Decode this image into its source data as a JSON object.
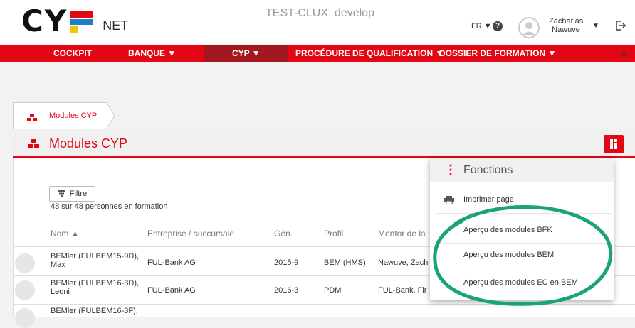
{
  "header": {
    "logo_letters": "CY",
    "logo_suffix": "NET",
    "env_title": "TEST-CLUX: develop",
    "language": "FR ▼",
    "help_label": "?",
    "user_first": "Zacharias",
    "user_last": "Nawuve",
    "user_caret": "▼"
  },
  "nav": {
    "items": [
      "COCKPIT",
      "BANQUE ▼",
      "CYP ▼",
      "PROCÉDURE DE QUALIFICATION ▼",
      "DOSSIER DE FORMATION ▼"
    ],
    "star": "★"
  },
  "breadcrumb": {
    "label": "Modules CYP"
  },
  "panel": {
    "title": "Modules CYP",
    "filter_label": "Filtre",
    "count_text": "48 sur 48 personnes en formation"
  },
  "table": {
    "columns": [
      "Nom ▲",
      "Entreprise / succursale",
      "Gén.",
      "Profil",
      "Mentor de la"
    ],
    "rows": [
      {
        "name1": "BEMler (FULBEM15-9D),",
        "name2": "Max",
        "company": "FUL-Bank AG",
        "gen": "2015-9",
        "profile": "BEM (HMS)",
        "mentor": "Nawuve, Zach"
      },
      {
        "name1": "BEMler (FULBEM16-3D),",
        "name2": "Leoni",
        "company": "FUL-Bank AG",
        "gen": "2016-3",
        "profile": "PDM",
        "mentor": "FUL-Bank, Fir"
      },
      {
        "name1": "BEMler (FULBEM16-3F),",
        "name2": "",
        "company": "",
        "gen": "",
        "profile": "",
        "mentor": ""
      }
    ]
  },
  "functions_menu": {
    "title": "Fonctions",
    "items": [
      "Imprimer page",
      "Aperçu des modules BFK",
      "Aperçu des modules BEM",
      "Aperçu des modules EC en BEM"
    ]
  },
  "colors": {
    "brand_red": "#e30613",
    "active_nav": "#a3171e",
    "highlight_ellipse": "#1aa37a"
  }
}
